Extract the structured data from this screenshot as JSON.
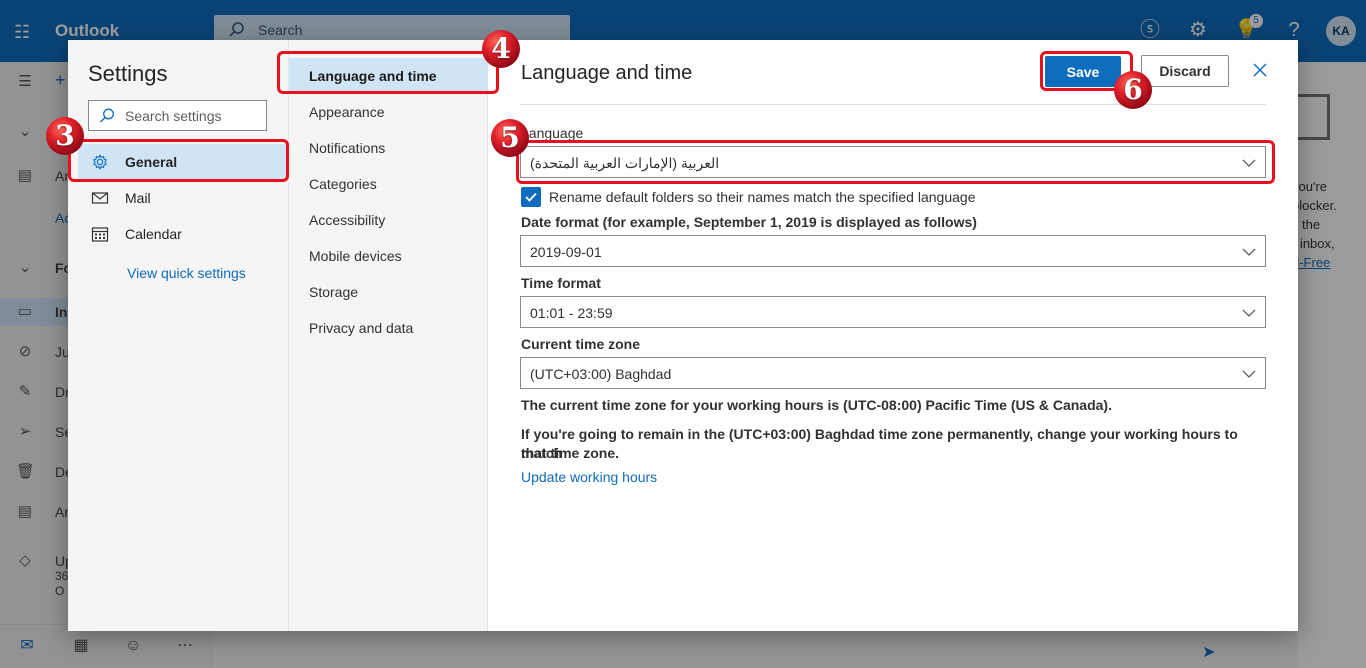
{
  "topbar": {
    "app_name": "Outlook",
    "search_placeholder": "Search",
    "notification_count": "5",
    "avatar_initials": "KA"
  },
  "background_nav": {
    "rows": [
      {
        "icon": "folder-icon",
        "label": "Ar"
      },
      {
        "icon": "",
        "label": "Ac"
      },
      {
        "icon": "chevron-down-icon",
        "label": "Fo"
      },
      {
        "icon": "inbox-icon",
        "label": "In"
      },
      {
        "icon": "junk-icon",
        "label": "Ju"
      },
      {
        "icon": "draft-icon",
        "label": "Dr"
      },
      {
        "icon": "send-icon",
        "label": "Se"
      },
      {
        "icon": "trash-icon",
        "label": "De"
      },
      {
        "icon": "archive-icon",
        "label": "Ar"
      },
      {
        "icon": "diamond-icon",
        "label": "Up"
      }
    ],
    "quota_line2": "36",
    "quota_line3": "O"
  },
  "background_reading": {
    "lines": [
      "you're",
      "blocker.",
      "the",
      "r inbox,",
      "d-Free"
    ]
  },
  "settings": {
    "title": "Settings",
    "search_placeholder": "Search settings",
    "categories": [
      {
        "label": "General",
        "icon": "gear-icon",
        "selected": true
      },
      {
        "label": "Mail",
        "icon": "mail-icon",
        "selected": false
      },
      {
        "label": "Calendar",
        "icon": "calendar-icon",
        "selected": false
      }
    ],
    "quick_settings_link": "View quick settings",
    "subcategories": [
      {
        "label": "Language and time",
        "selected": true
      },
      {
        "label": "Appearance"
      },
      {
        "label": "Notifications"
      },
      {
        "label": "Categories"
      },
      {
        "label": "Accessibility"
      },
      {
        "label": "Mobile devices"
      },
      {
        "label": "Storage"
      },
      {
        "label": "Privacy and data"
      }
    ]
  },
  "pane": {
    "title": "Language and time",
    "save_label": "Save",
    "discard_label": "Discard",
    "language_label": "Language",
    "language_value": "العربية (الإمارات العربية المتحدة)",
    "rename_checkbox_label": "Rename default folders so their names match the specified language",
    "rename_checked": true,
    "date_format_label": "Date format (for example, September 1, 2019 is displayed as follows)",
    "date_format_value": "2019-09-01",
    "time_format_label": "Time format",
    "time_format_value": "01:01 - 23:59",
    "time_zone_label": "Current time zone",
    "time_zone_value": "(UTC+03:00) Baghdad",
    "working_hours_note": "The current time zone for your working hours is (UTC-08:00) Pacific Time (US & Canada).",
    "remain_note_line1": "If you're going to remain in the (UTC+03:00) Baghdad time zone permanently, change your working hours to match",
    "remain_note_line2": "that time zone.",
    "update_link": "Update working hours"
  },
  "annotations": {
    "highlight_color": "#e8101c",
    "steps": [
      "3",
      "4",
      "5",
      "6"
    ]
  },
  "colors": {
    "brand": "#0f6cbd",
    "selected": "#cfe4f5"
  }
}
